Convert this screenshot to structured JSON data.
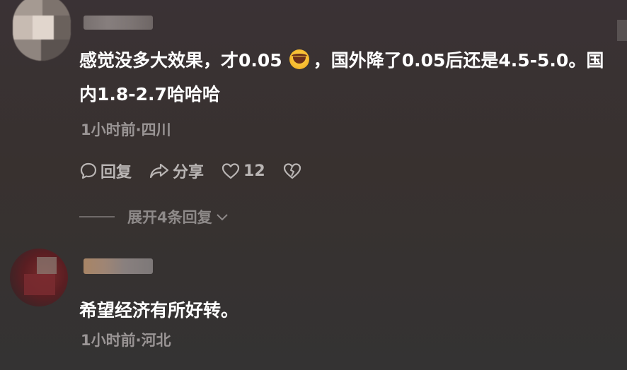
{
  "comments": [
    {
      "text_before_emoji": "感觉没多大效果，才0.05",
      "emoji": "rofl-emoji",
      "text_after_emoji": "，国外降了0.05后还是4.5-5.0。国内1.8-2.7哈哈哈",
      "meta": "1小时前·四川",
      "actions": {
        "reply_label": "回复",
        "share_label": "分享",
        "like_count": "12"
      },
      "expand_label": "展开4条回复"
    },
    {
      "text": "希望经济有所好转。",
      "meta": "1小时前·河北"
    }
  ],
  "colors": {
    "text_primary": "#ffffff",
    "text_meta": "#9a9595",
    "background_top": "#3a3235",
    "background_bottom": "#343333"
  },
  "icons": [
    "comment-bubble-icon",
    "share-arrow-icon",
    "heart-icon",
    "broken-heart-icon",
    "chevron-down-icon"
  ]
}
